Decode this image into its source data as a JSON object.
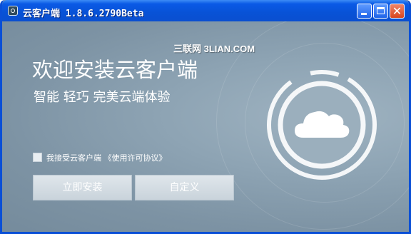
{
  "window": {
    "title": "云客户端 1.8.6.2790Beta",
    "controls": {
      "minimize": "minimize-icon",
      "maximize": "maximize-icon",
      "close": "close-icon",
      "close_glyph": "✕"
    }
  },
  "content": {
    "watermark": "三联网 3LIAN.COM",
    "headline": "欢迎安装云客户端",
    "subline": "智能 轻巧 完美云端体验",
    "agreement": {
      "checked": false,
      "label": "我接受云客户端 《使用许可协议》"
    },
    "buttons": {
      "install": "立即安装",
      "custom": "自定义"
    },
    "logo_icon": "cloud-logo-icon"
  },
  "colors": {
    "titlebar": "#0852d6",
    "background": "#8ea4b4",
    "close_button": "#d9461e"
  }
}
